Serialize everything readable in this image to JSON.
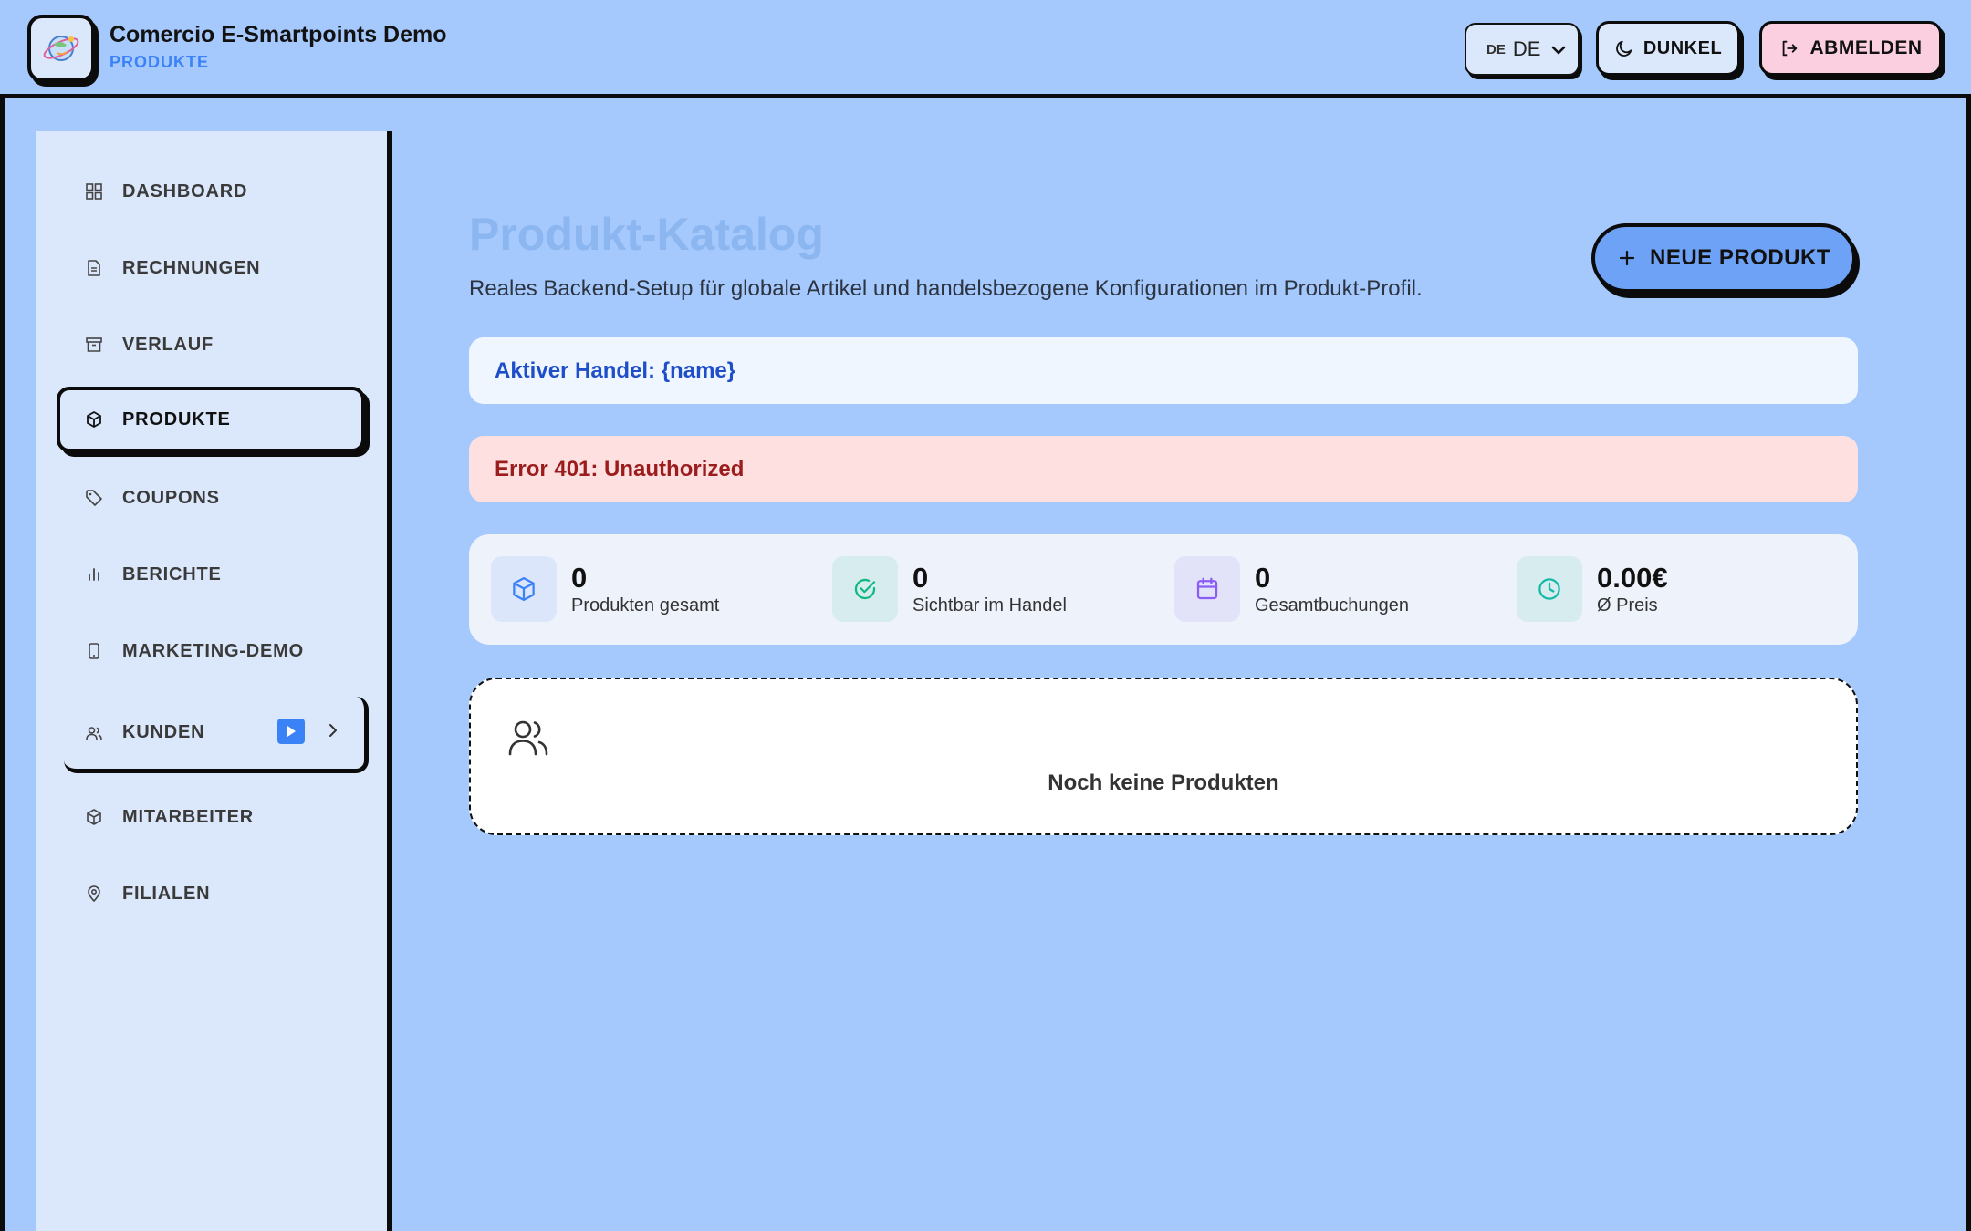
{
  "header": {
    "app_title": "Comercio E-Smartpoints Demo",
    "section": "PRODUKTE",
    "language": {
      "flag": "DE",
      "value": "DE"
    },
    "theme_label": "DUNKEL",
    "logout_label": "ABMELDEN"
  },
  "sidebar": {
    "items": [
      {
        "label": "DASHBOARD",
        "icon": "grid-icon"
      },
      {
        "label": "RECHNUNGEN",
        "icon": "document-icon"
      },
      {
        "label": "VERLAUF",
        "icon": "archive-icon"
      },
      {
        "label": "PRODUKTE",
        "icon": "package-icon",
        "active": true
      },
      {
        "label": "COUPONS",
        "icon": "tag-icon"
      },
      {
        "label": "BERICHTE",
        "icon": "bar-chart-icon"
      },
      {
        "label": "MARKETING-DEMO",
        "icon": "tablet-icon"
      },
      {
        "label": "KUNDEN",
        "icon": "users-icon",
        "expandable": true
      },
      {
        "label": "MITARBEITER",
        "icon": "package-icon"
      },
      {
        "label": "FILIALEN",
        "icon": "map-pin-icon"
      }
    ]
  },
  "main": {
    "title": "Produkt-Katalog",
    "subtitle": "Reales Backend-Setup für globale Artikel und handelsbezogene Konfigurationen im Produkt-Profil.",
    "new_button_label": "NEUE PRODUKT",
    "active_merchant": "Aktiver Handel: {name}",
    "error": "Error 401: Unauthorized",
    "stats": [
      {
        "value": "0",
        "label": "Produkten gesamt",
        "icon": "box-icon",
        "color": "#3b82f6",
        "bg": "#dbe6fb"
      },
      {
        "value": "0",
        "label": "Sichtbar im Handel",
        "icon": "check-circle-icon",
        "color": "#10b981",
        "bg": "#d7ecef"
      },
      {
        "value": "0",
        "label": "Gesamtbuchungen",
        "icon": "calendar-icon",
        "color": "#8b5cf6",
        "bg": "#e2e2f9"
      },
      {
        "value": "0.00€",
        "label": "Ø Preis",
        "icon": "clock-icon",
        "color": "#14b8a6",
        "bg": "#d7ecef"
      }
    ],
    "empty_state": "Noch keine Produkten"
  },
  "colors": {
    "background": "#a5c9fd",
    "sidebar": "#dbe8fb",
    "accent": "#3b82f6",
    "title": "#8cb6ef",
    "primary_button": "#6ea2f6",
    "logout_button": "#fbcfe0",
    "error_bg": "#fee0e0",
    "error_text": "#9b1c1c",
    "info_bg": "#eff6ff",
    "info_text": "#1e4fc9"
  }
}
